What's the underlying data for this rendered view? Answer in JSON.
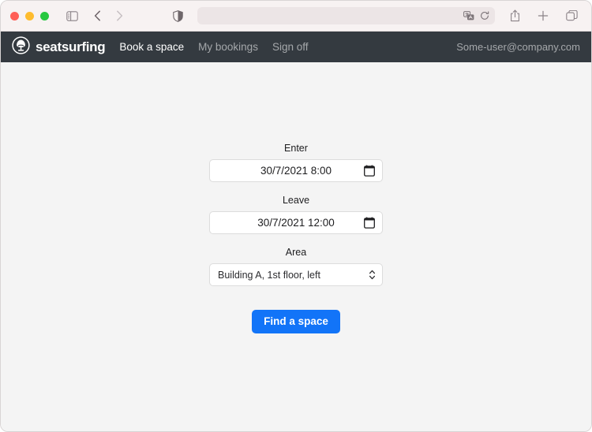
{
  "browser": {
    "traffic_lights": [
      "close",
      "minimize",
      "maximize"
    ],
    "sidebar_icon": "sidebar-toggle-icon",
    "back_icon": "chevron-left-icon",
    "forward_icon": "chevron-right-icon",
    "shield_icon": "privacy-shield-icon",
    "url_value": "",
    "url_placeholder": "",
    "translate_icon": "translate-icon",
    "reload_icon": "reload-icon",
    "share_icon": "share-icon",
    "new_tab_icon": "plus-icon",
    "tab_overview_icon": "tab-overview-icon"
  },
  "navbar": {
    "brand": "seatsurfing",
    "brand_icon": "seat-logo-icon",
    "links": [
      {
        "label": "Book a space",
        "active": true
      },
      {
        "label": "My bookings",
        "active": false
      },
      {
        "label": "Sign off",
        "active": false
      }
    ],
    "user_email": "Some-user@company.com",
    "background_color": "#343a40"
  },
  "form": {
    "enter": {
      "label": "Enter",
      "value": "30/7/2021 8:00",
      "icon": "calendar-icon"
    },
    "leave": {
      "label": "Leave",
      "value": "30/7/2021 12:00",
      "icon": "calendar-icon"
    },
    "area": {
      "label": "Area",
      "value": "Building A, 1st floor, left",
      "icon": "select-stepper-icon"
    },
    "submit": {
      "label": "Find a space",
      "color": "#1274f8"
    }
  },
  "page": {
    "background_color": "#f4f4f4"
  }
}
